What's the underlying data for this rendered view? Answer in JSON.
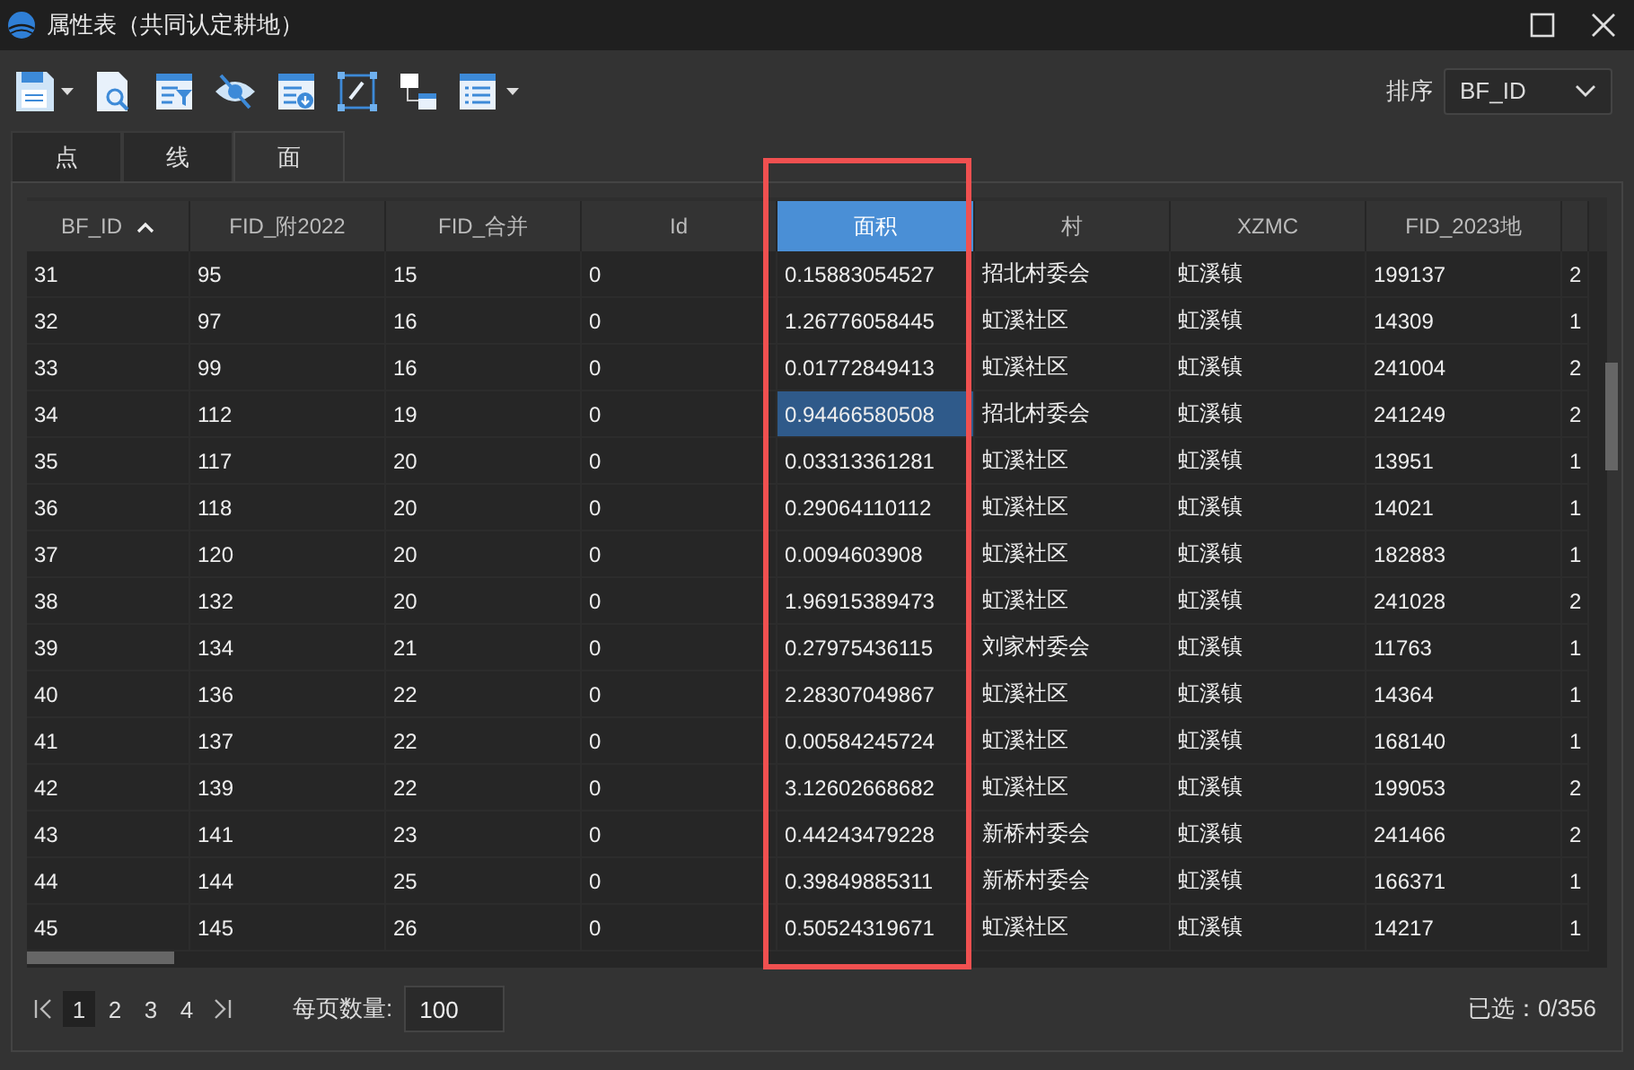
{
  "window": {
    "title": "属性表（共同认定耕地）"
  },
  "toolbar": {
    "sort_label": "排序",
    "sort_value": "BF_ID"
  },
  "tabs": [
    {
      "label": "点",
      "selected": false
    },
    {
      "label": "线",
      "selected": false
    },
    {
      "label": "面",
      "selected": true
    }
  ],
  "table": {
    "columns": [
      {
        "label": "BF_ID",
        "sorted": true,
        "selected": false
      },
      {
        "label": "FID_附2022",
        "sorted": false,
        "selected": false
      },
      {
        "label": "FID_合并",
        "sorted": false,
        "selected": false
      },
      {
        "label": "Id",
        "sorted": false,
        "selected": false
      },
      {
        "label": "面积",
        "sorted": false,
        "selected": true
      },
      {
        "label": "村",
        "sorted": false,
        "selected": false
      },
      {
        "label": "XZMC",
        "sorted": false,
        "selected": false
      },
      {
        "label": "FID_2023地",
        "sorted": false,
        "selected": false
      },
      {
        "sorted": false,
        "selected": false
      }
    ],
    "rows": [
      {
        "cells": [
          "31",
          "95",
          "15",
          "0",
          "0.15883054527",
          "招北村委会",
          "虹溪镇",
          "199137",
          "2"
        ],
        "selected": false
      },
      {
        "cells": [
          "32",
          "97",
          "16",
          "0",
          "1.26776058445",
          "虹溪社区",
          "虹溪镇",
          "14309",
          "1"
        ],
        "selected": false
      },
      {
        "cells": [
          "33",
          "99",
          "16",
          "0",
          "0.01772849413",
          "虹溪社区",
          "虹溪镇",
          "241004",
          "2"
        ],
        "selected": false
      },
      {
        "cells": [
          "34",
          "112",
          "19",
          "0",
          "0.94466580508",
          "招北村委会",
          "虹溪镇",
          "241249",
          "2"
        ],
        "selected": true
      },
      {
        "cells": [
          "35",
          "117",
          "20",
          "0",
          "0.03313361281",
          "虹溪社区",
          "虹溪镇",
          "13951",
          "1"
        ],
        "selected": false
      },
      {
        "cells": [
          "36",
          "118",
          "20",
          "0",
          "0.29064110112",
          "虹溪社区",
          "虹溪镇",
          "14021",
          "1"
        ],
        "selected": false
      },
      {
        "cells": [
          "37",
          "120",
          "20",
          "0",
          "0.0094603908",
          "虹溪社区",
          "虹溪镇",
          "182883",
          "1"
        ],
        "selected": false
      },
      {
        "cells": [
          "38",
          "132",
          "20",
          "0",
          "1.96915389473",
          "虹溪社区",
          "虹溪镇",
          "241028",
          "2"
        ],
        "selected": false
      },
      {
        "cells": [
          "39",
          "134",
          "21",
          "0",
          "0.27975436115",
          "刘家村委会",
          "虹溪镇",
          "11763",
          "1"
        ],
        "selected": false
      },
      {
        "cells": [
          "40",
          "136",
          "22",
          "0",
          "2.28307049867",
          "虹溪社区",
          "虹溪镇",
          "14364",
          "1"
        ],
        "selected": false
      },
      {
        "cells": [
          "41",
          "137",
          "22",
          "0",
          "0.00584245724",
          "虹溪社区",
          "虹溪镇",
          "168140",
          "1"
        ],
        "selected": false
      },
      {
        "cells": [
          "42",
          "139",
          "22",
          "0",
          "3.12602668682",
          "虹溪社区",
          "虹溪镇",
          "199053",
          "2"
        ],
        "selected": false
      },
      {
        "cells": [
          "43",
          "141",
          "23",
          "0",
          "0.44243479228",
          "新桥村委会",
          "虹溪镇",
          "241466",
          "2"
        ],
        "selected": false
      },
      {
        "cells": [
          "44",
          "144",
          "25",
          "0",
          "0.39849885311",
          "新桥村委会",
          "虹溪镇",
          "166371",
          "1"
        ],
        "selected": false
      },
      {
        "cells": [
          "45",
          "145",
          "26",
          "0",
          "0.50524319671",
          "虹溪社区",
          "虹溪镇",
          "14217",
          "1"
        ],
        "selected": false
      }
    ]
  },
  "pagination": {
    "pages": [
      {
        "label": "1",
        "selected": true
      },
      {
        "label": "2",
        "selected": false
      },
      {
        "label": "3",
        "selected": false
      },
      {
        "label": "4",
        "selected": false
      }
    ],
    "per_page_label": "每页数量:",
    "per_page": "100"
  },
  "status": "已选：0/356"
}
